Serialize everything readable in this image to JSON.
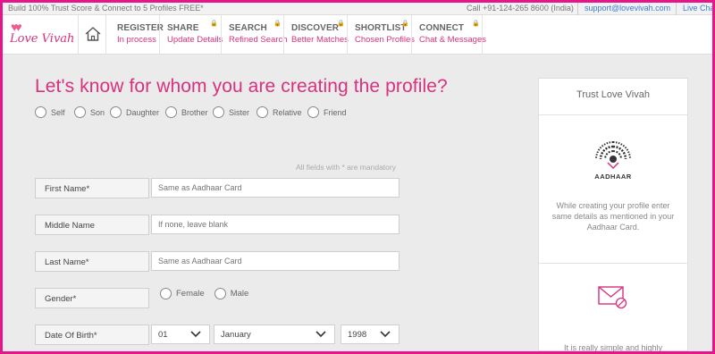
{
  "topbar": {
    "promo": "Build 100% Trust Score & Connect to 5 Profiles FREE*",
    "phone": "Call +91-124-265 8600 (India)",
    "email": "support@lovevivah.com",
    "chat": "Live Chat"
  },
  "brand": {
    "logo_text": "Love Vivah"
  },
  "nav": {
    "steps": [
      {
        "title": "REGISTER",
        "sub": "In process"
      },
      {
        "title": "SHARE",
        "sub": "Update Details"
      },
      {
        "title": "SEARCH",
        "sub": "Refined Search"
      },
      {
        "title": "DISCOVER",
        "sub": "Better Matches"
      },
      {
        "title": "SHORTLIST",
        "sub": "Chosen Profiles"
      },
      {
        "title": "CONNECT",
        "sub": "Chat & Messages"
      }
    ]
  },
  "form": {
    "heading": "Let's know for whom you are creating the profile?",
    "relations": [
      "Self",
      "Son",
      "Daughter",
      "Brother",
      "Sister",
      "Relative",
      "Friend"
    ],
    "mandatory_note": "All fields with * are mandatory",
    "first_name": {
      "label": "First Name*",
      "placeholder": "Same as Aadhaar Card"
    },
    "middle_name": {
      "label": "Middle Name",
      "placeholder": "If none, leave blank"
    },
    "last_name": {
      "label": "Last Name*",
      "placeholder": "Same as Aadhaar Card"
    },
    "gender": {
      "label": "Gender*",
      "options": [
        "Female",
        "Male"
      ]
    },
    "dob": {
      "label": "Date Of Birth*",
      "day": "01",
      "month": "January",
      "year": "1998"
    }
  },
  "sidebar": {
    "title": "Trust Love Vivah",
    "aadhaar_label": "AADHAAR",
    "aadhaar_text": "While creating your profile enter same details as mentioned in your Aadhaar Card.",
    "mail_text": "It is really simple and highly"
  },
  "colors": {
    "brand_pink": "#d8317e",
    "frame_border": "#e6168a"
  }
}
